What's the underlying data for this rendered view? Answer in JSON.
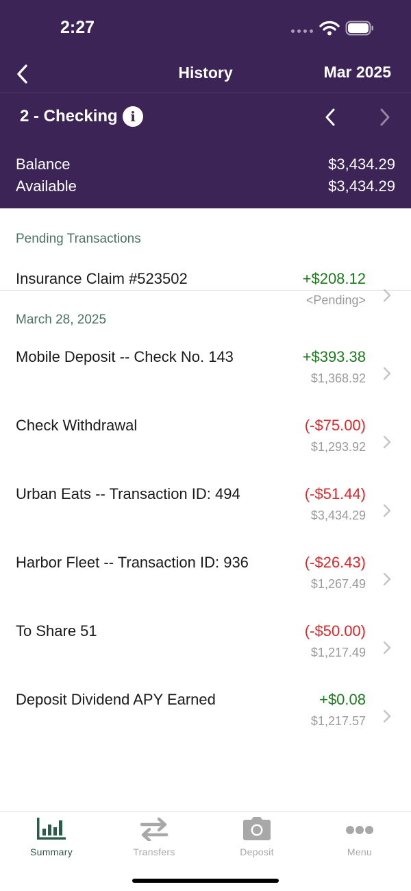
{
  "colors": {
    "header_bg": "#3d2456",
    "positive": "#1e7a1e",
    "negative": "#e0262a",
    "section_label": "#4a7262",
    "active_tab": "#2e5a4a"
  },
  "status_bar": {
    "time": "2:27",
    "icons": [
      "signal-icon",
      "wifi-icon",
      "battery-icon"
    ]
  },
  "nav": {
    "back_icon": "chevron-left-icon",
    "title": "History",
    "month": "Mar 2025"
  },
  "account": {
    "name": "2 - Checking",
    "info_icon": "i",
    "prev_icon": "chevron-left-icon",
    "next_icon": "chevron-right-icon"
  },
  "balances": {
    "balance_label": "Balance",
    "balance_value": "$3,434.29",
    "available_label": "Available",
    "available_value": "$3,434.29"
  },
  "pending": {
    "header": "Pending Transactions",
    "items": [
      {
        "description": "Insurance Claim #523502",
        "amount": "+$208.12",
        "status": "<Pending>",
        "type": "pos"
      }
    ]
  },
  "posted": {
    "header": "March 28, 2025",
    "items": [
      {
        "description": "Mobile Deposit -- Check No. 143",
        "amount": "+$393.38",
        "balance": "$1,368.92",
        "type": "pos"
      },
      {
        "description": "Check Withdrawal",
        "amount": "(-$75.00)",
        "balance": "$1,293.92",
        "type": "neg"
      },
      {
        "description": "Urban Eats -- Transaction ID: 494",
        "amount": "(-$51.44)",
        "balance": "$3,434.29",
        "type": "neg"
      },
      {
        "description": "Harbor Fleet -- Transaction ID: 936",
        "amount": "(-$26.43)",
        "balance": "$1,267.49",
        "type": "neg"
      },
      {
        "description": "To Share 51",
        "amount": "(-$50.00)",
        "balance": "$1,217.49",
        "type": "neg"
      },
      {
        "description": "Deposit Dividend APY Earned",
        "amount": "+$0.08",
        "balance": "$1,217.57",
        "type": "pos"
      }
    ]
  },
  "tabs": [
    {
      "label": "Summary",
      "icon": "bar-chart-icon",
      "active": true
    },
    {
      "label": "Transfers",
      "icon": "transfer-arrows-icon",
      "active": false
    },
    {
      "label": "Deposit",
      "icon": "camera-icon",
      "active": false
    },
    {
      "label": "Menu",
      "icon": "more-dots-icon",
      "active": false
    }
  ]
}
